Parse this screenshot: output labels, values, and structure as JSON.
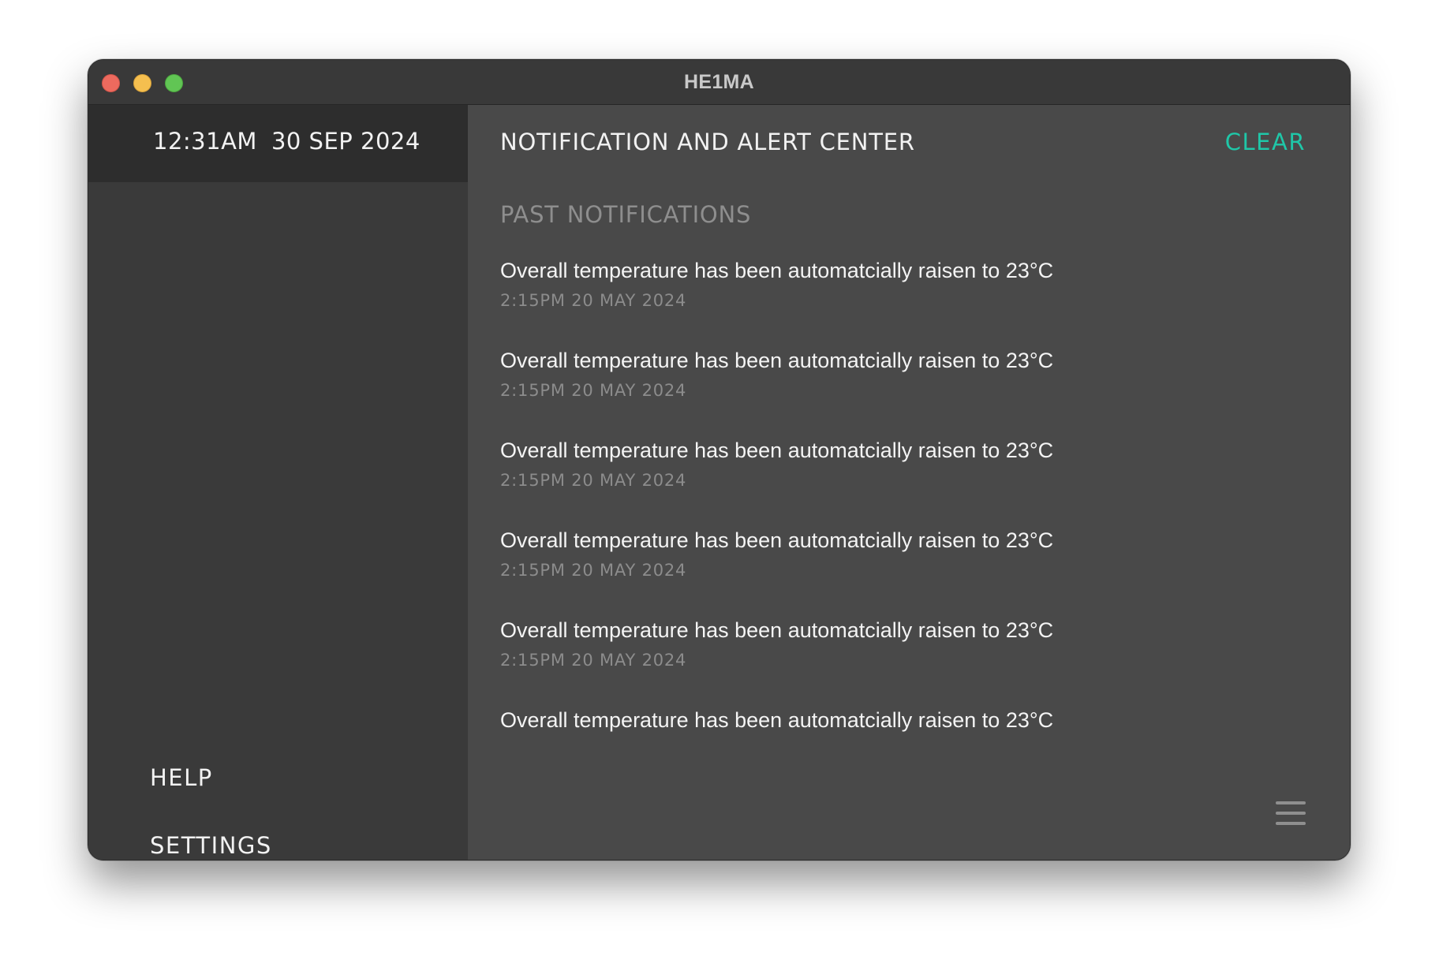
{
  "window": {
    "title": "HE1MA"
  },
  "sidebar": {
    "time": "12:31AM",
    "date": "30 SEP 2024",
    "help_label": "HELP",
    "settings_label": "SETTINGS"
  },
  "main": {
    "title": "NOTIFICATION AND ALERT CENTER",
    "clear_label": "CLEAR",
    "section_title": "PAST NOTIFICATIONS",
    "notifications": [
      {
        "message": "Overall temperature has been automatcially raisen to 23°C",
        "timestamp": "2:15PM 20 MAY 2024"
      },
      {
        "message": "Overall temperature has been automatcially raisen to 23°C",
        "timestamp": "2:15PM 20 MAY 2024"
      },
      {
        "message": "Overall temperature has been automatcially raisen to 23°C",
        "timestamp": "2:15PM 20 MAY 2024"
      },
      {
        "message": "Overall temperature has been automatcially raisen to 23°C",
        "timestamp": "2:15PM 20 MAY 2024"
      },
      {
        "message": "Overall temperature has been automatcially raisen to 23°C",
        "timestamp": "2:15PM 20 MAY 2024"
      },
      {
        "message": "Overall temperature has been automatcially raisen to 23°C"
      }
    ],
    "menu_icon": "hamburger-menu-icon"
  },
  "colors": {
    "accent": "#1fc7a8",
    "sidebar_bg": "#3a3a3a",
    "clock_bar_bg": "#2d2d2d",
    "main_bg": "#494949",
    "titlebar_bg": "#393939",
    "muted_text": "#8e8e8e"
  }
}
